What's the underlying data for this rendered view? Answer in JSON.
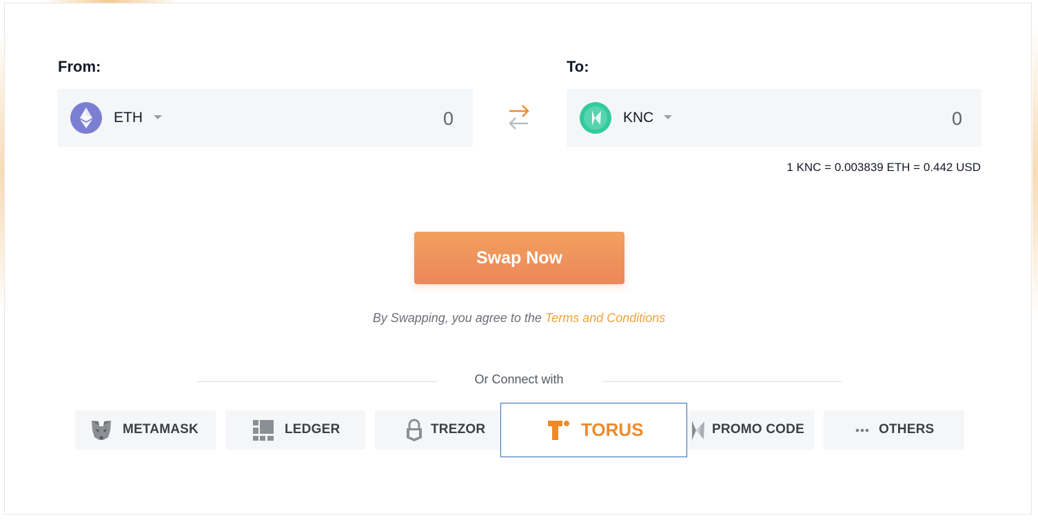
{
  "from": {
    "label": "From:",
    "token": "ETH",
    "amount": "0",
    "icon": "ethereum-icon"
  },
  "to": {
    "label": "To:",
    "token": "KNC",
    "amount": "0",
    "icon": "kyber-icon"
  },
  "rate": "1 KNC = 0.003839 ETH = 0.442 USD",
  "swap_button": "Swap Now",
  "terms": {
    "prefix": "By Swapping, you agree to the ",
    "link": "Terms and Conditions"
  },
  "connect": {
    "label": "Or Connect with",
    "wallets": [
      {
        "label": "METAMASK",
        "icon": "metamask-fox-icon"
      },
      {
        "label": "LEDGER",
        "icon": "ledger-icon"
      },
      {
        "label": "TREZOR",
        "icon": "trezor-lock-icon"
      },
      {
        "label": "TORUS",
        "icon": "torus-icon"
      },
      {
        "label": "PROMO CODE",
        "icon": "kyber-icon"
      },
      {
        "label": "OTHERS",
        "icon": "more-dots-icon"
      }
    ]
  },
  "colors": {
    "accent_orange": "#ec8759",
    "link_orange": "#f0a23e",
    "torus_border": "#2e6ab2",
    "field_bg": "#f5f6f8",
    "eth_purple": "#7b7fd1",
    "knc_green": "#31cb9e"
  }
}
